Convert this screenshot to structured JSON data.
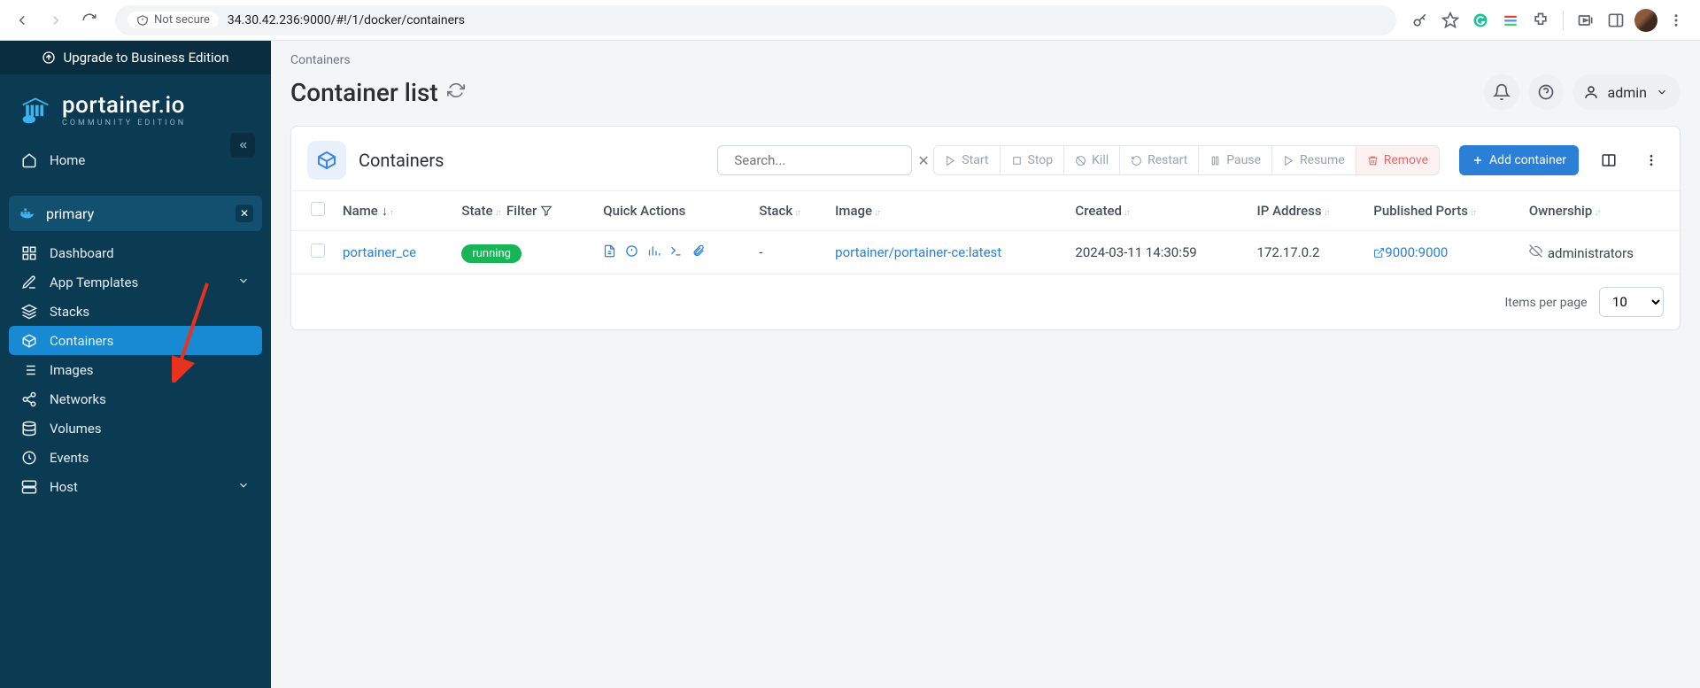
{
  "browser": {
    "not_secure": "Not secure",
    "url": "34.30.42.236:9000/#!/1/docker/containers"
  },
  "sidebar": {
    "upgrade": "Upgrade to Business Edition",
    "logo": {
      "main": "portainer.io",
      "sub": "COMMUNITY EDITION"
    },
    "home": "Home",
    "env_name": "primary",
    "items": [
      {
        "label": "Dashboard"
      },
      {
        "label": "App Templates",
        "chevron": true
      },
      {
        "label": "Stacks"
      },
      {
        "label": "Containers",
        "active": true
      },
      {
        "label": "Images"
      },
      {
        "label": "Networks"
      },
      {
        "label": "Volumes"
      },
      {
        "label": "Events"
      },
      {
        "label": "Host",
        "chevron": true
      }
    ]
  },
  "header": {
    "breadcrumb": "Containers",
    "title": "Container list",
    "user": "admin"
  },
  "card": {
    "title": "Containers",
    "search_placeholder": "Search...",
    "buttons": {
      "start": "Start",
      "stop": "Stop",
      "kill": "Kill",
      "restart": "Restart",
      "pause": "Pause",
      "resume": "Resume",
      "remove": "Remove",
      "add": "Add container"
    },
    "columns": {
      "name": "Name",
      "state": "State",
      "filter": "Filter",
      "quick": "Quick Actions",
      "stack": "Stack",
      "image": "Image",
      "created": "Created",
      "ip": "IP Address",
      "ports": "Published Ports",
      "owner": "Ownership"
    },
    "rows": [
      {
        "name": "portainer_ce",
        "state": "running",
        "stack": "-",
        "image": "portainer/portainer-ce:latest",
        "created": "2024-03-11 14:30:59",
        "ip": "172.17.0.2",
        "ports": "9000:9000",
        "owner": "administrators"
      }
    ],
    "footer": {
      "items_per_page": "Items per page",
      "value": "10"
    }
  }
}
